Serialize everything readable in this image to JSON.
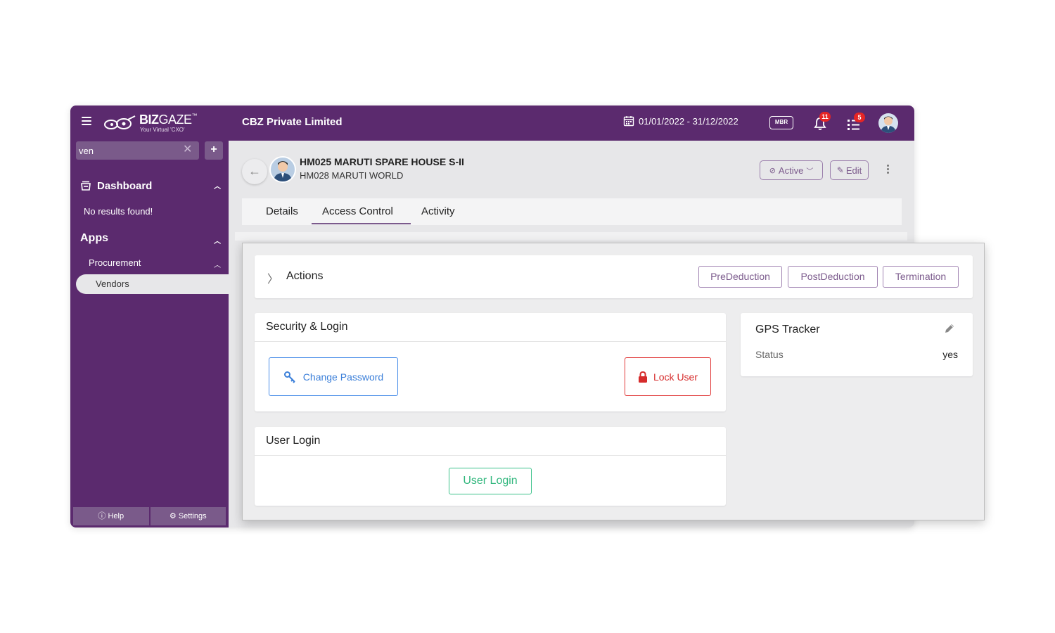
{
  "colors": {
    "brand": "#5b2a6e",
    "accent": "#7b5a8c",
    "blue": "#3b7fd9",
    "red": "#d62b2b",
    "green": "#2fb67c",
    "badge": "#e62525"
  },
  "topbar": {
    "logo_main": "BIZ",
    "logo_light": "GAZE",
    "logo_tm": "™",
    "logo_sub": "Your Virtual 'CXO'",
    "company": "CBZ Private Limited",
    "date_range": "01/01/2022 - 31/12/2022",
    "mbr_label": "MBR",
    "notifications_count": "11",
    "tasks_count": "5"
  },
  "sidebar": {
    "search_value": "ven",
    "add_label": "+",
    "dashboard_label": "Dashboard",
    "no_results": "No results found!",
    "apps_label": "Apps",
    "procurement_label": "Procurement",
    "vendors_label": "Vendors",
    "help_label": "Help",
    "settings_label": "Settings"
  },
  "header": {
    "title": "HM025 MARUTI SPARE HOUSE S-II",
    "subtitle": "HM028 MARUTI WORLD",
    "status_label": "Active",
    "edit_label": "Edit"
  },
  "tabs": [
    {
      "label": "Details"
    },
    {
      "label": "Access Control"
    },
    {
      "label": "Activity"
    }
  ],
  "actions": {
    "title": "Actions",
    "buttons": [
      "PreDeduction",
      "PostDeduction",
      "Termination"
    ]
  },
  "security": {
    "title": "Security & Login",
    "change_password": "Change Password",
    "lock_user": "Lock User"
  },
  "user_login": {
    "title": "User Login",
    "button": "User Login"
  },
  "gps": {
    "title": "GPS Tracker",
    "status_label": "Status",
    "status_value": "yes"
  }
}
